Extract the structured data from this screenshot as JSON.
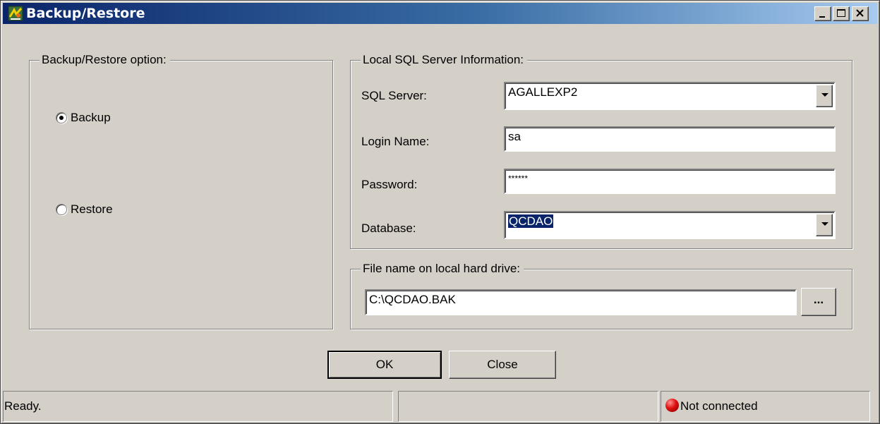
{
  "window": {
    "title": "Backup/Restore",
    "minimize_label": "_",
    "maximize_label": "□",
    "close_label": "✕"
  },
  "options_group": {
    "legend": "Backup/Restore option:",
    "backup_label": "Backup",
    "restore_label": "Restore",
    "selected": "Backup"
  },
  "sql_group": {
    "legend": "Local SQL Server Information:",
    "server_label": "SQL Server:",
    "server_value": "AGALLEXP2",
    "login_label": "Login Name:",
    "login_value": "sa",
    "password_label": "Password:",
    "password_value": "******",
    "database_label": "Database:",
    "database_value": "QCDAO"
  },
  "file_group": {
    "legend": "File name on local hard drive:",
    "file_value": "C:\\QCDAO.BAK",
    "browse_label": "..."
  },
  "buttons": {
    "ok_label": "OK",
    "close_label": "Close"
  },
  "statusbar": {
    "status_text": "Ready.",
    "middle_text": "",
    "connection_text": "Not connected",
    "connection_color": "#e01010"
  },
  "icons": {
    "app": "backup-restore-app-icon",
    "dropdown": "chevron-down-icon",
    "status": "red-status-led-icon"
  }
}
